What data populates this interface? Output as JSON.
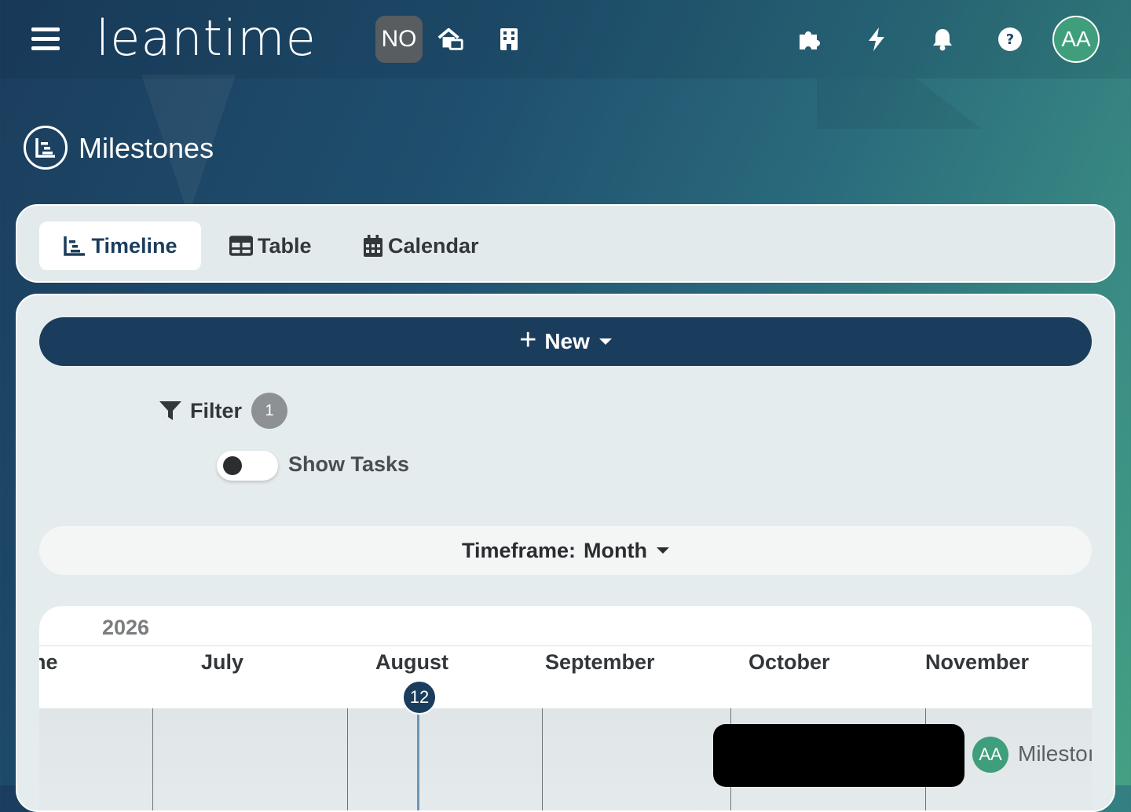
{
  "header": {
    "logo": "leantime",
    "project_badge": "NO",
    "avatar_initials": "AA",
    "icons": [
      "menu-icon",
      "home-switch-icon",
      "building-icon",
      "puzzle-icon",
      "bolt-icon",
      "bell-icon",
      "help-icon"
    ]
  },
  "page": {
    "title": "Milestones",
    "title_icon": "timeline-icon"
  },
  "tabs": [
    {
      "label": "Timeline",
      "icon": "timeline-icon",
      "active": true
    },
    {
      "label": "Table",
      "icon": "table-icon",
      "active": false
    },
    {
      "label": "Calendar",
      "icon": "calendar-icon",
      "active": false
    }
  ],
  "toolbar": {
    "new_label": "New",
    "filter_label": "Filter",
    "filter_count": "1",
    "show_tasks_label": "Show Tasks",
    "show_tasks_on": false,
    "timeframe_label": "Timeframe:",
    "timeframe_value": "Month"
  },
  "timeline": {
    "year": "2026",
    "months": [
      "ne",
      "July",
      "August",
      "September",
      "October",
      "November"
    ],
    "today_day": "12",
    "milestone": {
      "owner_initials": "AA",
      "label": "Milestoı"
    }
  },
  "colors": {
    "primary": "#1b3d5d",
    "accent_green": "#3f9e7c",
    "card_bg": "#e5ecee"
  }
}
